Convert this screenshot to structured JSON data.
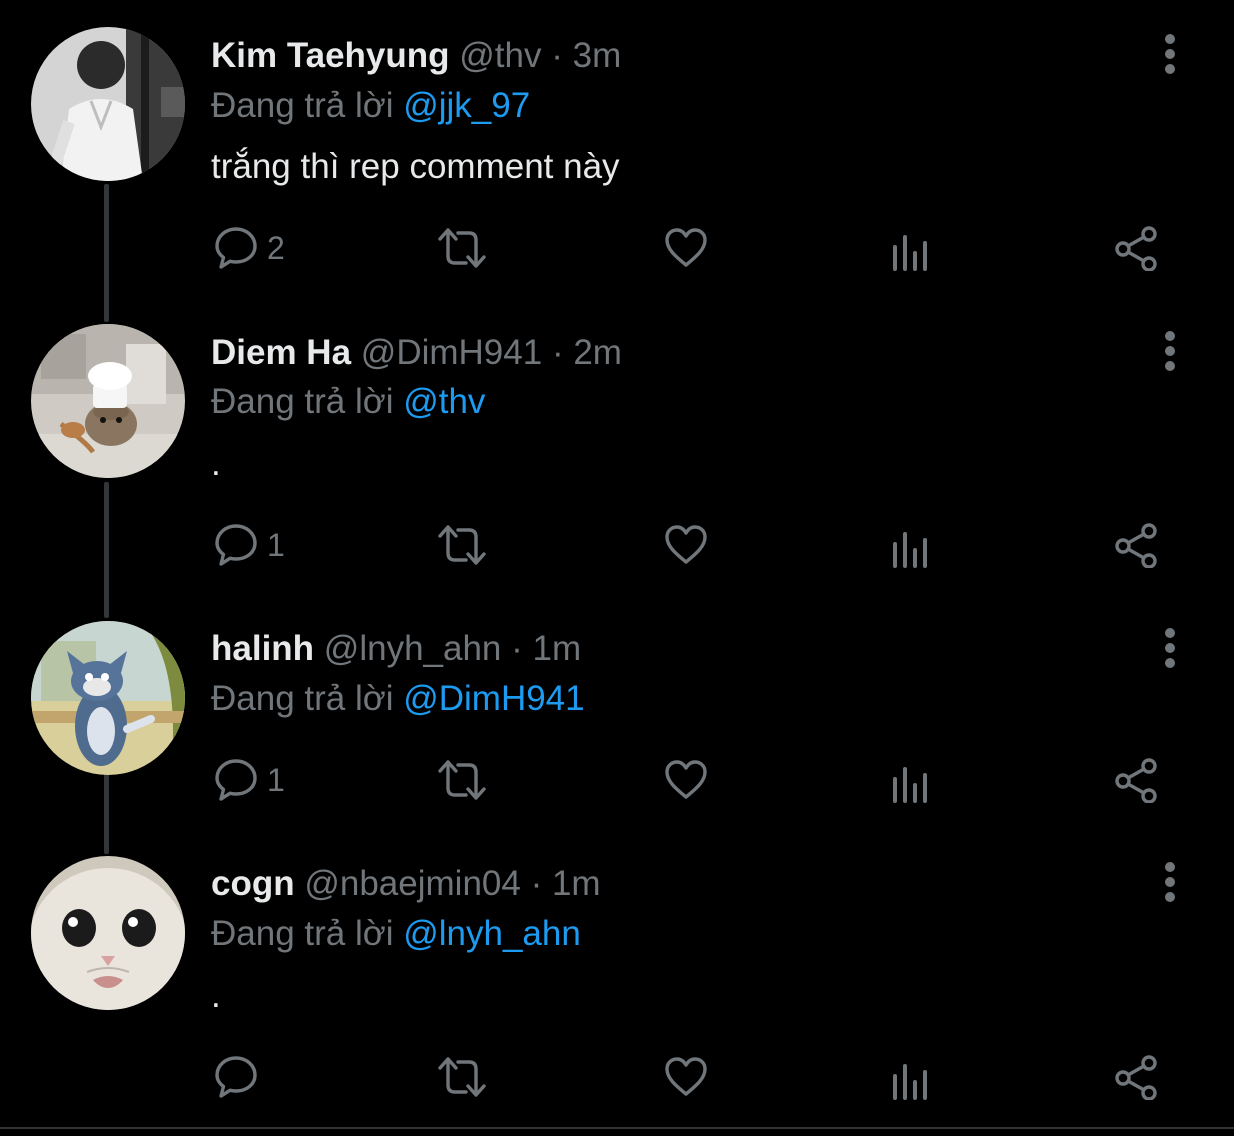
{
  "tweets": [
    {
      "display_name": "Kim Taehyung",
      "handle": "@thv",
      "separator": "·",
      "time": "3m",
      "reply_prefix": "Đang trả lời",
      "reply_to": "@jjk_97",
      "text": "trắng thì rep comment này",
      "reply_count": "2",
      "avatar_icon": "avatar-photo-monochrome-person"
    },
    {
      "display_name": "Diem Ha",
      "handle": "@DimH941",
      "separator": "·",
      "time": "2m",
      "reply_prefix": "Đang trả lời",
      "reply_to": "@thv",
      "text": ".",
      "reply_count": "1",
      "avatar_icon": "avatar-photo-hamster-chef"
    },
    {
      "display_name": "halinh",
      "handle": "@lnyh_ahn",
      "separator": "·",
      "time": "1m",
      "reply_prefix": "Đang trả lời",
      "reply_to": "@DimH941",
      "text": "",
      "reply_count": "1",
      "avatar_icon": "avatar-cartoon-cat"
    },
    {
      "display_name": "cogn",
      "handle": "@nbaejmin04",
      "separator": "·",
      "time": "1m",
      "reply_prefix": "Đang trả lời",
      "reply_to": "@lnyh_ahn",
      "text": ".",
      "reply_count": "",
      "avatar_icon": "avatar-photo-white-kitten"
    }
  ],
  "icons": {
    "reply": "reply-icon",
    "retweet": "retweet-icon",
    "like": "heart-icon",
    "views": "views-icon",
    "share": "share-icon",
    "more": "more-vertical-icon"
  },
  "colors": {
    "background": "#000000",
    "text_primary": "#e7e9ea",
    "text_secondary": "#71767b",
    "link": "#1d9bf0",
    "thread_line": "#333639"
  }
}
